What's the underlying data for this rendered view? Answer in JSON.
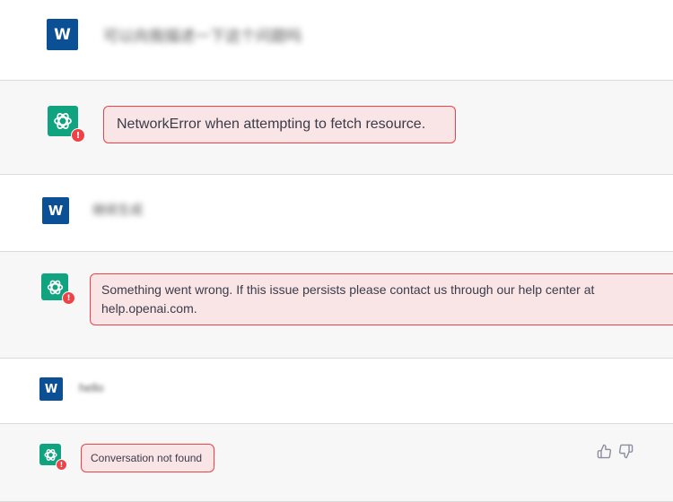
{
  "messages": [
    {
      "role": "user",
      "avatar_letter": "W",
      "text": "可以向我描述一下这个问题吗"
    },
    {
      "role": "assistant",
      "error_badge": "!",
      "error": "NetworkError when attempting to fetch resource."
    },
    {
      "role": "user",
      "avatar_letter": "W",
      "text": "继续生成"
    },
    {
      "role": "assistant",
      "error_badge": "!",
      "error": "Something went wrong. If this issue persists please contact us through our help center at help.openai.com."
    },
    {
      "role": "user",
      "avatar_letter": "W",
      "text": "hello"
    },
    {
      "role": "assistant",
      "error_badge": "!",
      "error": "Conversation not found"
    }
  ],
  "feedback": {
    "thumbs_up_icon": "thumbs-up-icon",
    "thumbs_down_icon": "thumbs-down-icon"
  },
  "colors": {
    "user_avatar": "#0b4f94",
    "assistant_avatar": "#10a37f",
    "error_red": "#ef4146",
    "error_bg": "#f9e5e6",
    "assistant_row_bg": "#f7f7f8"
  }
}
